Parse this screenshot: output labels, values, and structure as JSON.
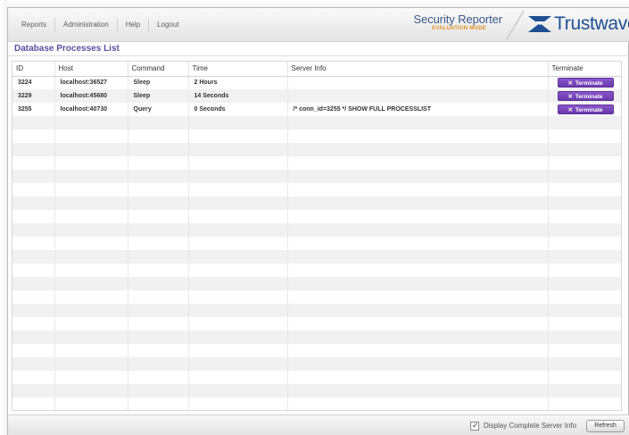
{
  "nav": {
    "items": [
      {
        "label": "Reports"
      },
      {
        "label": "Administration"
      },
      {
        "label": "Help"
      },
      {
        "label": "Logout"
      }
    ]
  },
  "brand": {
    "product": "Security Reporter",
    "mode": "EVALUATION MODE",
    "logo_text": "Trustwave",
    "logo_reg": "®"
  },
  "page": {
    "title": "Database Processes List"
  },
  "table": {
    "columns": [
      "ID",
      "Host",
      "Command",
      "Time",
      "Server Info",
      "Terminate"
    ],
    "rows": [
      {
        "id": "3224",
        "host": "localhost:36527",
        "command": "Sleep",
        "time": "2 Hours",
        "server_info": "",
        "action": "Terminate"
      },
      {
        "id": "3229",
        "host": "localhost:45680",
        "command": "Sleep",
        "time": "14 Seconds",
        "server_info": "",
        "action": "Terminate"
      },
      {
        "id": "3255",
        "host": "localhost:40730",
        "command": "Query",
        "time": "0 Seconds",
        "server_info": "/* conn_id=3255 */ SHOW FULL PROCESSLIST",
        "action": "Terminate"
      }
    ]
  },
  "footer": {
    "checkbox_label": "Display Complete Server Info",
    "checkbox_checked": true,
    "refresh_label": "Refresh"
  },
  "colors": {
    "accent": "#5c4fa0",
    "terminate_button": "#7a48bd",
    "brand_blue": "#1d4f93",
    "brand_orange": "#e0902a"
  }
}
